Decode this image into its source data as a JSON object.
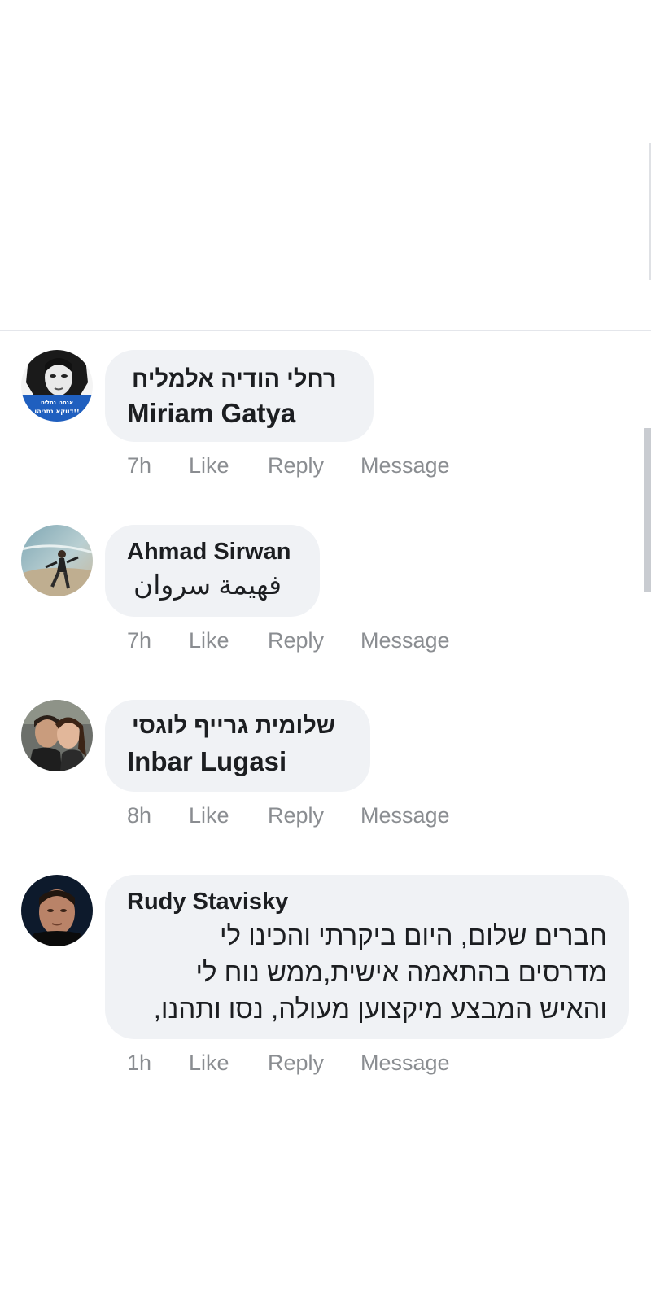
{
  "colors": {
    "bubble_background": "#f0f2f5",
    "meta_text": "#8a8d91",
    "primary_text": "#1c1e21",
    "divider": "#e4e6eb",
    "scrollbar": "#c9ccd1"
  },
  "comments": [
    {
      "author": "רחלי הודיה אלמליח",
      "text": "Miriam Gatya",
      "time": "7h",
      "like_label": "Like",
      "reply_label": "Reply",
      "message_label": "Message",
      "avatar_text_line1": "אנחנו נחליט",
      "avatar_text_line2": "דווקא נתניהו!!"
    },
    {
      "author": "Ahmad Sirwan",
      "text": "فهيمة سروان",
      "time": "7h",
      "like_label": "Like",
      "reply_label": "Reply",
      "message_label": "Message"
    },
    {
      "author": "שלומית גרייף לוגסי",
      "text": "Inbar Lugasi",
      "time": "8h",
      "like_label": "Like",
      "reply_label": "Reply",
      "message_label": "Message"
    },
    {
      "author": "Rudy Stavisky",
      "text_lines": [
        "חברים שלום, היום ביקרתי והכינו לי",
        "מדרסים בהתאמה אישית,ממש נוח לי",
        "והאיש המבצע מיקצוען מעולה, נסו ותהנו,"
      ],
      "time": "1h",
      "like_label": "Like",
      "reply_label": "Reply",
      "message_label": "Message"
    }
  ]
}
